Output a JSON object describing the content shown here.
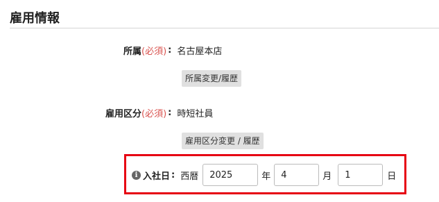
{
  "section": {
    "title": "雇用情報"
  },
  "affiliation": {
    "label": "所属",
    "required": "(必須)",
    "colon": ":",
    "value": "名古屋本店",
    "change_button": "所属変更/履歴"
  },
  "employment_type": {
    "label": "雇用区分",
    "required": "(必須)",
    "colon": ":",
    "value": "時短社員",
    "change_button": "雇用区分変更 / 履歴"
  },
  "hire_date": {
    "info_icon": "info-icon",
    "label": "入社日",
    "colon": ":",
    "era": "西暦",
    "year": "2025",
    "year_unit": "年",
    "month": "4",
    "month_unit": "月",
    "day": "1",
    "day_unit": "日"
  },
  "colors": {
    "required": "#d9534f",
    "highlight_border": "#e60012",
    "button_bg": "#e0e0e0"
  }
}
